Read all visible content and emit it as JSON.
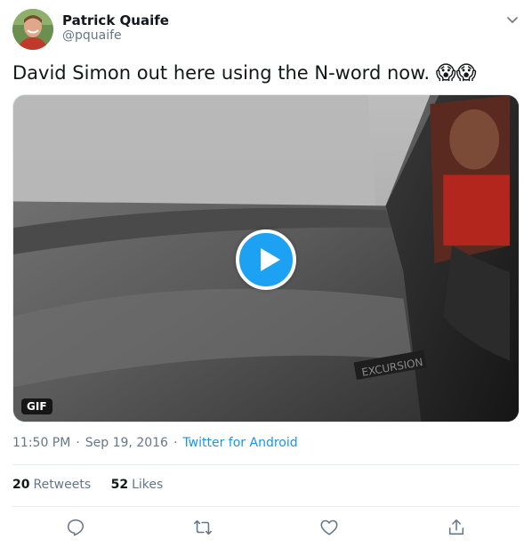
{
  "user": {
    "display_name": "Patrick Quaife",
    "handle": "@pquaife"
  },
  "tweet": {
    "text": "David Simon out here using the N-word now.",
    "emoji": "😱😱"
  },
  "media": {
    "badge": "GIF",
    "type": "gif",
    "plate_text": "EXCURSION"
  },
  "meta": {
    "time": "11:50 PM",
    "separator": "·",
    "date": "Sep 19, 2016",
    "source": "Twitter for Android"
  },
  "stats": {
    "retweets_count": "20",
    "retweets_label": "Retweets",
    "likes_count": "52",
    "likes_label": "Likes"
  },
  "icons": {
    "menu": "chevron-down-icon",
    "reply": "reply-icon",
    "retweet": "retweet-icon",
    "like": "heart-icon",
    "share": "share-icon",
    "play": "play-icon"
  },
  "colors": {
    "accent": "#1da1f2",
    "link": "#1b95e0",
    "secondary_text": "#657786",
    "primary_text": "#14171a"
  }
}
